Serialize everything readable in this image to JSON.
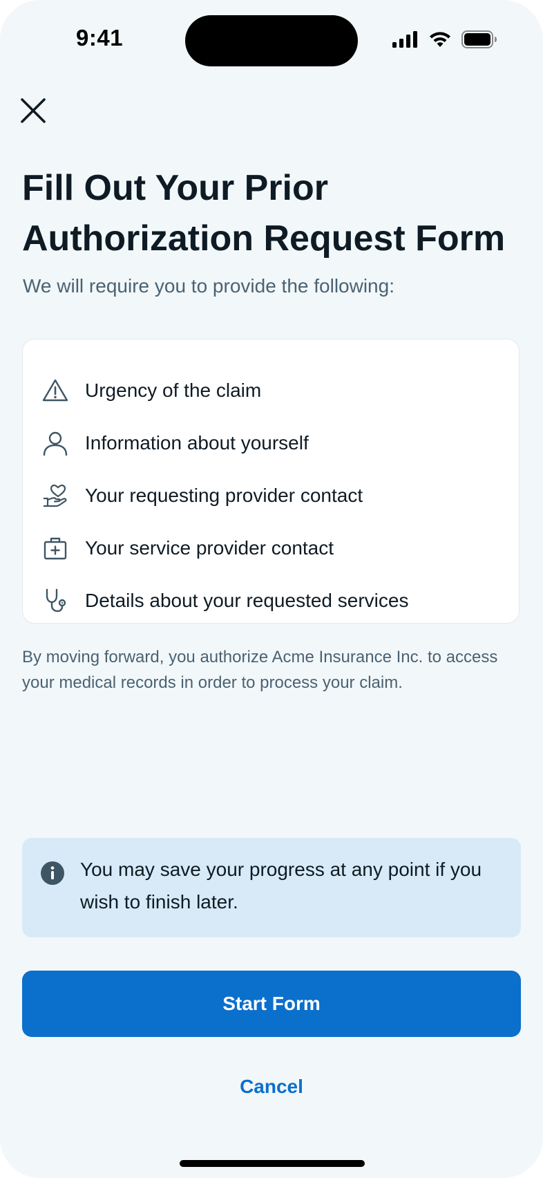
{
  "status_bar": {
    "time": "9:41",
    "icons": [
      "cellular-signal-icon",
      "wifi-icon",
      "battery-icon"
    ]
  },
  "header": {
    "close_icon": "close-icon"
  },
  "main": {
    "title": "Fill Out Your Prior Authorization Request Form",
    "subtitle": "We will require you to provide the following:",
    "requirements": [
      {
        "icon": "warning-triangle-icon",
        "label": "Urgency of the claim"
      },
      {
        "icon": "user-icon",
        "label": "Information about yourself"
      },
      {
        "icon": "hand-heart-icon",
        "label": "Your requesting provider contact"
      },
      {
        "icon": "medical-kit-icon",
        "label": "Your service provider contact"
      },
      {
        "icon": "stethoscope-icon",
        "label": "Details about your requested services"
      }
    ],
    "disclaimer": "By moving forward, you authorize Acme Insurance Inc. to access your medical records in order to process your claim."
  },
  "info_banner": {
    "icon": "info-icon",
    "text": "You may save your progress at any point if you wish to finish later."
  },
  "actions": {
    "start_label": "Start Form",
    "cancel_label": "Cancel"
  },
  "colors": {
    "background": "#f2f7fa",
    "primary": "#0b6fcc",
    "info_banner_bg": "#d8eaf7",
    "text_primary": "#0f1b24",
    "text_secondary": "#4a6272",
    "icon_stroke": "#3e5564"
  }
}
